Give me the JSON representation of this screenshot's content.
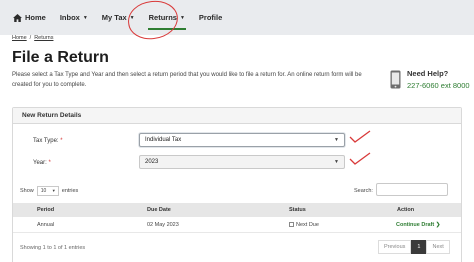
{
  "nav": {
    "home": "Home",
    "inbox": "Inbox",
    "mytax": "My Tax",
    "returns": "Returns",
    "profile": "Profile"
  },
  "breadcrumb": {
    "home": "Home",
    "sep": "/",
    "returns": "Returns"
  },
  "page": {
    "title": "File a Return",
    "intro": "Please select a Tax Type and Year and then select a return period that you would like to file a return for. An online return form will be created for you to complete."
  },
  "help": {
    "title": "Need Help?",
    "phone": "227-6060 ext 8000"
  },
  "panel": {
    "title": "New Return Details",
    "tax_type_label": "Tax Type:",
    "tax_type_value": "Individual Tax",
    "year_label": "Year:",
    "year_value": "2023",
    "required_mark": "*"
  },
  "table_controls": {
    "show": "Show",
    "entries_value": "10",
    "entries": "entries",
    "search": "Search:"
  },
  "table": {
    "headers": [
      "Period",
      "Due Date",
      "Status",
      "Action"
    ],
    "rows": [
      {
        "period": "Annual",
        "due": "02 May 2023",
        "status": "Next Due",
        "action": "Continue Draft ❯"
      }
    ]
  },
  "footer": {
    "info": "Showing 1 to 1 of 1 entries",
    "previous": "Previous",
    "page": "1",
    "next": "Next"
  },
  "colors": {
    "accent": "#2e7d32",
    "annotation": "#d93a3a",
    "required": "#d32f2f"
  }
}
